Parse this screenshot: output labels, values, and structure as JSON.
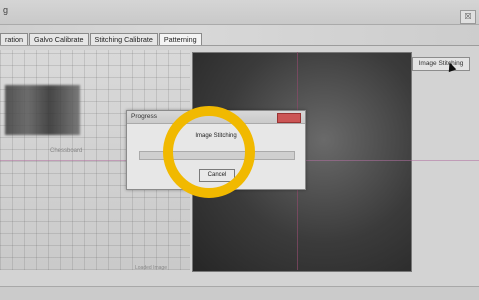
{
  "window": {
    "title_fragment": "g",
    "close_label": "☒"
  },
  "tabs": [
    {
      "label": "ration"
    },
    {
      "label": "Galvo Calibrate"
    },
    {
      "label": "Stitching Calibrate"
    },
    {
      "label": "Patterning"
    }
  ],
  "left_panel": {
    "label": "Chessboard",
    "bottom_label": "Loaded Image"
  },
  "right_panel": {
    "button_label": "Image Stitching"
  },
  "dialog": {
    "title": "Progress",
    "message": "Image Stitching",
    "progress_percent": 0,
    "cancel_label": "Cancel"
  },
  "colors": {
    "highlight_ring": "#f1b900",
    "dialog_close": "#cc5555"
  }
}
